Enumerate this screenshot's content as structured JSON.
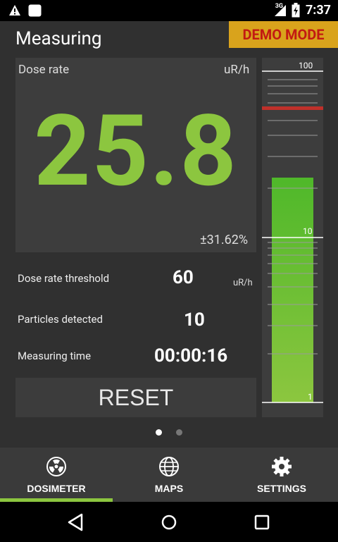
{
  "status_bar": {
    "time": "7:37",
    "network": "3G"
  },
  "header": {
    "title": "Measuring",
    "demo_badge": "DEMO MODE"
  },
  "dose": {
    "label": "Dose rate",
    "unit": "uR/h",
    "value": "25.8",
    "error": "±31.62%"
  },
  "rows": {
    "threshold": {
      "label": "Dose rate threshold",
      "value": "60",
      "unit": "uR/h"
    },
    "particles": {
      "label": "Particles detected",
      "value": "10"
    },
    "time": {
      "label": "Measuring time",
      "value": "00:00:16"
    }
  },
  "reset_label": "RESET",
  "gauge": {
    "tick_top": "100",
    "tick_mid": "10",
    "tick_bottom": "1",
    "fill_color": "#8cc63f",
    "threshold_color": "#c0302a"
  },
  "pager": {
    "pages": 2,
    "active": 0
  },
  "nav": {
    "items": [
      {
        "label": "DOSIMETER",
        "icon": "radiation-icon",
        "active": true
      },
      {
        "label": "MAPS",
        "icon": "globe-icon",
        "active": false
      },
      {
        "label": "SETTINGS",
        "icon": "gear-icon",
        "active": false
      }
    ]
  },
  "colors": {
    "accent": "#8cc63f",
    "demo_bg": "#d9a31c",
    "demo_text": "#c21a12"
  }
}
